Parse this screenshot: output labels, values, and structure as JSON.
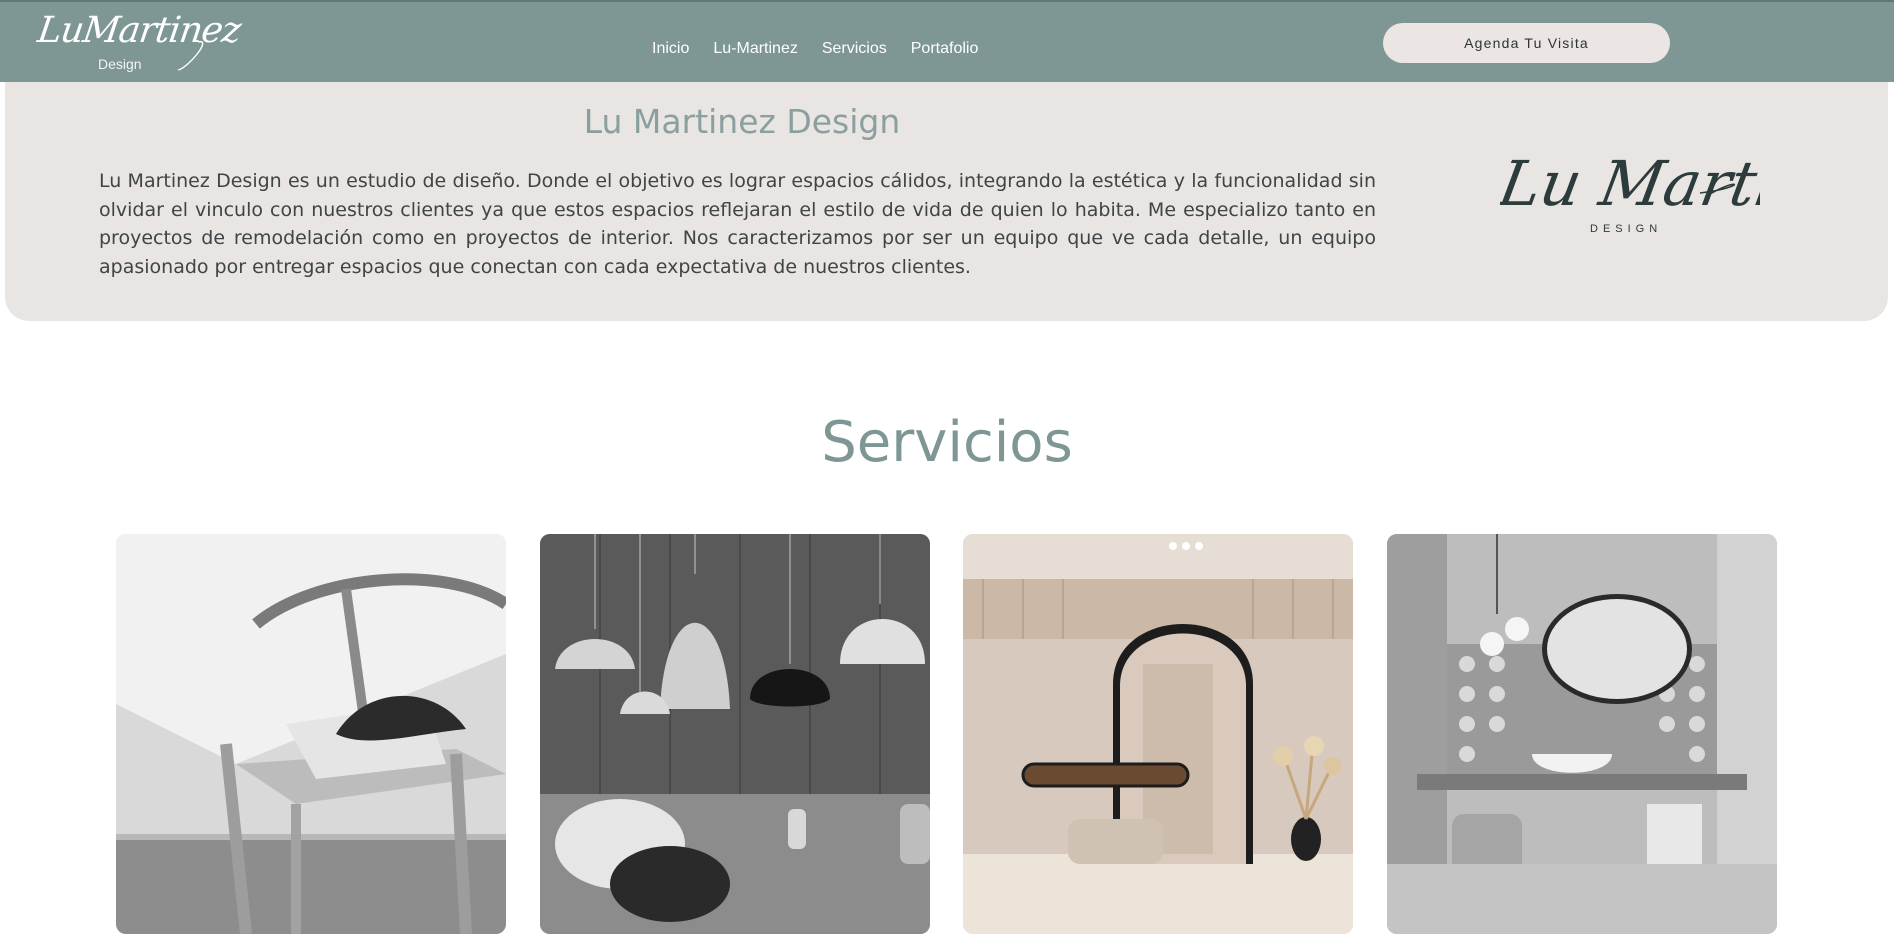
{
  "header": {
    "brand_script": "LuMartinez",
    "brand_sub": "Design",
    "nav": [
      {
        "label": "Inicio"
      },
      {
        "label": "Lu-Martinez"
      },
      {
        "label": "Servicios"
      },
      {
        "label": "Portafolio"
      }
    ],
    "cta_label": "Agenda Tu Visita"
  },
  "about": {
    "title": "Lu Martinez Design",
    "text": "Lu Martinez Design es un estudio de diseño. Donde el objetivo es lograr espacios cálidos, integrando la estética y la funcionalidad sin olvidar el vinculo con nuestros clientes ya que estos espacios reflejaran el estilo de vida de quien lo habita. Me especializo tanto en proyectos de remodelación como en proyectos de interior. Nos caracterizamos por ser un equipo que ve cada detalle, un equipo apasionado por entregar espacios que conectan con cada expectativa de nuestros clientes.",
    "logo_script": "Lu Martinez",
    "logo_sub": "DESIGN"
  },
  "services": {
    "title": "Servicios"
  },
  "colors": {
    "header_bg": "#7e9795",
    "about_bg": "#e9e5e3",
    "accent_text": "#7e9795",
    "cta_bg": "#ebe6e3"
  }
}
